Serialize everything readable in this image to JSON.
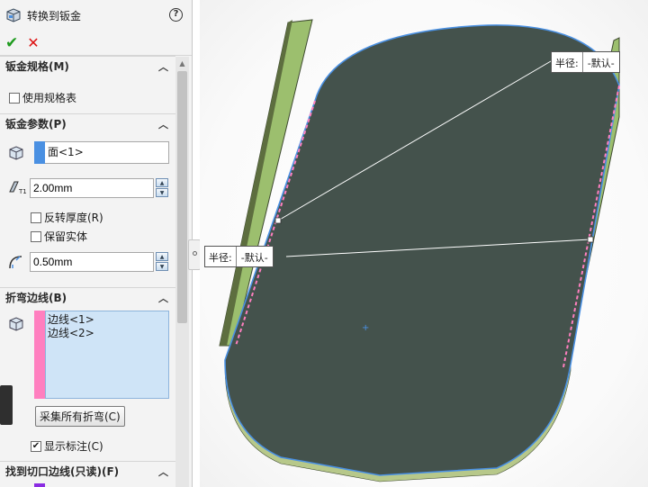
{
  "panel": {
    "title": "转换到钣金",
    "help": "?",
    "ok": "✔",
    "cancel": "✕"
  },
  "groups": {
    "gauge": {
      "title": "钣金规格(M)",
      "use_table": "使用规格表"
    },
    "params": {
      "title": "钣金参数(P)",
      "face": "面<1>",
      "thickness": "2.00mm",
      "reverse": "反转厚度(R)",
      "keep_body": "保留实体",
      "radius": "0.50mm"
    },
    "bend_edges": {
      "title": "折弯边线(B)",
      "items": [
        "边线<1>",
        "边线<2>"
      ],
      "collect_btn": "采集所有折弯(C)",
      "show_callouts": "显示标注(C)"
    },
    "rip_edges": {
      "title": "找到切口边线(只读)(F)"
    }
  },
  "callouts": [
    {
      "label": "半径:",
      "value": "-默认-"
    },
    {
      "label": "半径:",
      "value": "-默认-"
    }
  ],
  "colors": {
    "face_tag": "#4a90e2",
    "bend_tag": "#ff7fbf",
    "rip_tag": "#8a2be2",
    "model_face": "#44524c",
    "flange": "#9cbf6e"
  }
}
